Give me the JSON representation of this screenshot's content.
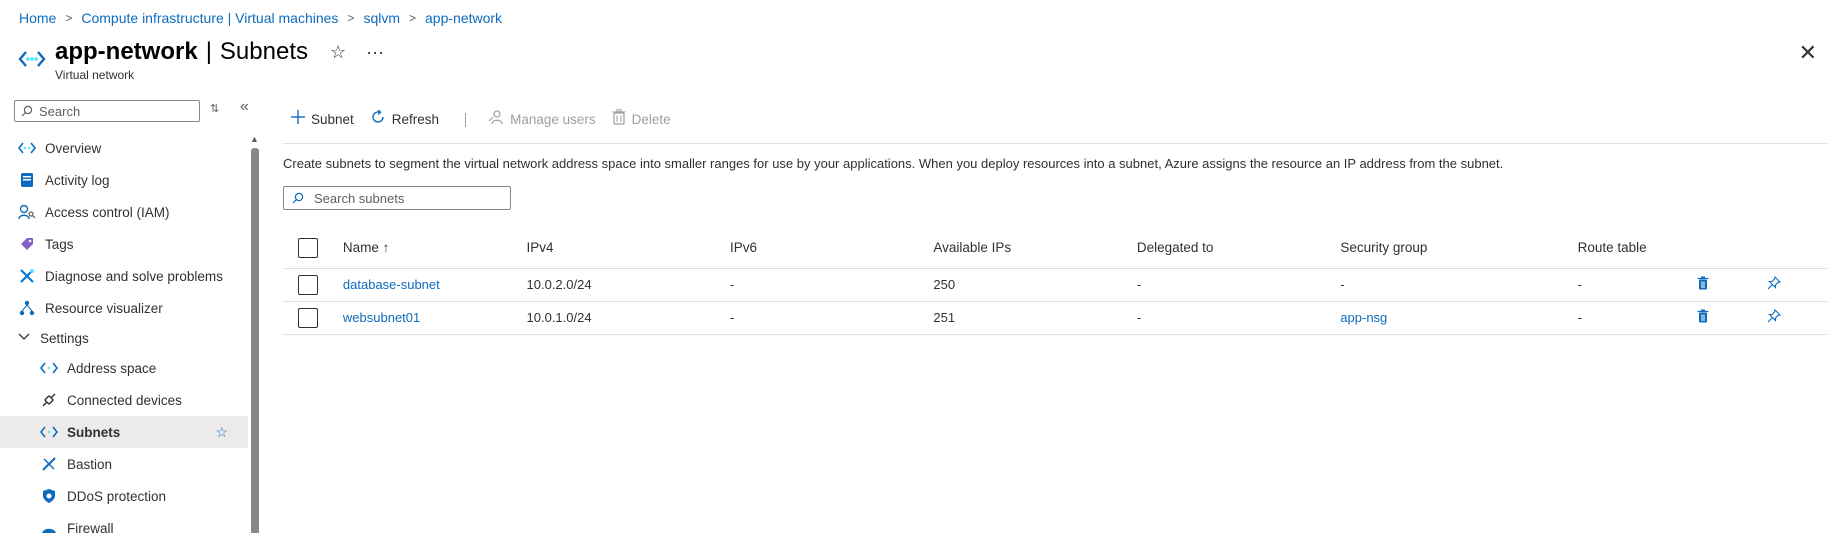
{
  "breadcrumb": [
    "Home",
    "Compute infrastructure | Virtual machines",
    "sqlvm",
    "app-network"
  ],
  "header": {
    "resource_name": "app-network",
    "separator": "|",
    "page": "Subnets",
    "subtitle": "Virtual network",
    "favorite_glyph": "☆",
    "more_glyph": "···",
    "close_glyph": "✕",
    "icon": "virtual-network-icon"
  },
  "sidebar": {
    "search_placeholder": "Search",
    "items": [
      {
        "label": "Overview",
        "icon": "vnet-overview-icon"
      },
      {
        "label": "Activity log",
        "icon": "activity-log-icon"
      },
      {
        "label": "Access control (IAM)",
        "icon": "iam-icon"
      },
      {
        "label": "Tags",
        "icon": "tag-icon"
      },
      {
        "label": "Diagnose and solve problems",
        "icon": "wrench-icon"
      },
      {
        "label": "Resource visualizer",
        "icon": "visualizer-icon"
      }
    ],
    "group": {
      "label": "Settings",
      "expanded": true
    },
    "sub_items": [
      {
        "label": "Address space",
        "icon": "address-space-icon"
      },
      {
        "label": "Connected devices",
        "icon": "plug-icon"
      },
      {
        "label": "Subnets",
        "icon": "subnet-icon",
        "selected": true
      },
      {
        "label": "Bastion",
        "icon": "bastion-icon"
      },
      {
        "label": "DDoS protection",
        "icon": "shield-icon"
      },
      {
        "label": "Firewall",
        "icon": "firewall-icon"
      }
    ]
  },
  "toolbar": {
    "subnet_label": "Subnet",
    "refresh_label": "Refresh",
    "manage_users_label": "Manage users",
    "delete_label": "Delete"
  },
  "description": "Create subnets to segment the virtual network address space into smaller ranges for use by your applications. When you deploy resources into a subnet, Azure assigns the resource an IP address from the subnet.",
  "grid_search_placeholder": "Search subnets",
  "table": {
    "columns": [
      "Name ↑",
      "IPv4",
      "IPv6",
      "Available IPs",
      "Delegated to",
      "Security group",
      "Route table"
    ],
    "rows": [
      {
        "name": "database-subnet",
        "ipv4": "10.0.2.0/24",
        "ipv6": "-",
        "available": "250",
        "delegated": "-",
        "security_group": "-",
        "route_table": "-"
      },
      {
        "name": "websubnet01",
        "ipv4": "10.0.1.0/24",
        "ipv6": "-",
        "available": "251",
        "delegated": "-",
        "security_group": "app-nsg",
        "route_table": "-"
      }
    ]
  },
  "colors": {
    "accent": "#0f6cbd",
    "selected_bg": "#edebe9",
    "text": "#323130"
  }
}
